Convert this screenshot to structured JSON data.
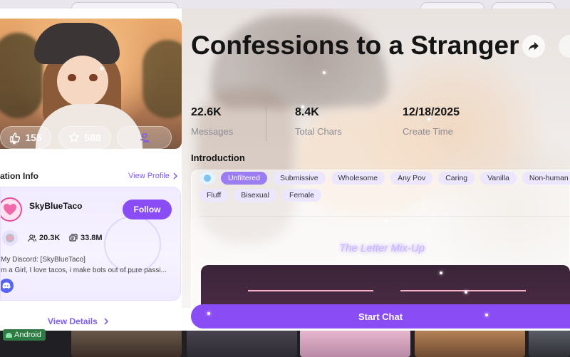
{
  "character": {
    "title": "Confessions to a Stranger",
    "likes": "155",
    "stars": "588"
  },
  "creator_section": {
    "heading": "ation Info",
    "view_profile": "View Profile",
    "name": "SkyBlueTaco",
    "follow_label": "Follow",
    "followers": "20.3K",
    "interactions": "33.8M",
    "bio_line1": "My Discord: [SkyBlueTaco]",
    "bio_line2": "m a Girl, I love tacos, i make bots out of pure passi...",
    "view_details": "View Details"
  },
  "metrics": [
    {
      "value": "22.6K",
      "label": "Messages"
    },
    {
      "value": "8.4K",
      "label": "Total Chars"
    },
    {
      "value": "12/18/2025",
      "label": "Create Time"
    }
  ],
  "introduction": {
    "heading": "Introduction",
    "tags_row1": [
      "Unfiltered",
      "Submissive",
      "Wholesome",
      "Any Pov",
      "Caring",
      "Vanilla",
      "Non-human"
    ],
    "tags_row2": [
      "Fluff",
      "Bisexual",
      "Female"
    ],
    "preview_title": "The Letter Mix-Up"
  },
  "actions": {
    "start_chat": "Start Chat"
  },
  "background": {
    "android_badge": "Android"
  },
  "colors": {
    "accent": "#8a4cf5",
    "link": "#7c5cf0",
    "tag_bg": "#ece6ff"
  },
  "icons": [
    "thumbs-up-icon",
    "star-icon",
    "heart-hand-icon",
    "chevron-right-icon",
    "share-icon",
    "followers-icon",
    "chats-icon",
    "discord-icon",
    "emoji-icon",
    "android-icon"
  ]
}
